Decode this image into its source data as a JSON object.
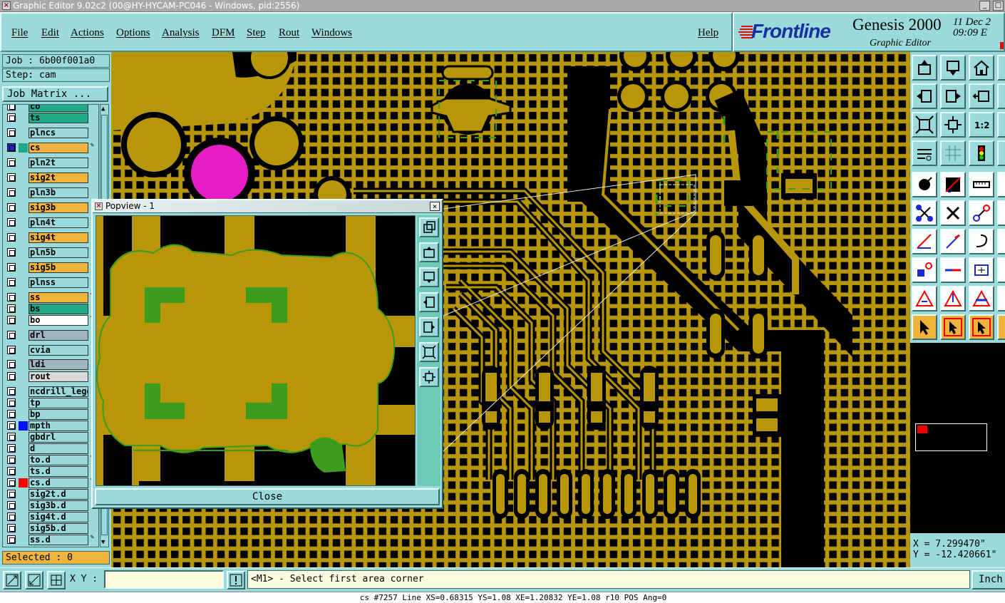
{
  "window": {
    "title": "Graphic Editor 9.02c2 (00@HY-HYCAM-PC046 - Windows, pid:2556)"
  },
  "menu": [
    "File",
    "Edit",
    "Actions",
    "Options",
    "Analysis",
    "DFM",
    "Step",
    "Rout",
    "Windows"
  ],
  "help_label": "Help",
  "brand": {
    "logo": "Frontline",
    "product": "Genesis 2000",
    "subtitle": "Graphic Editor",
    "date": "11 Dec 2\n09:09 E"
  },
  "job": {
    "job_label": "Job : 6b00f001a0",
    "step_label": "Step: cam",
    "matrix_button": "Job Matrix ..."
  },
  "layers": [
    {
      "name": "co",
      "color": "#1fa987",
      "tool": ""
    },
    {
      "name": "ts",
      "color": "#1fa987",
      "tool": ""
    },
    {
      "name": "plncs",
      "color": "#9bdada",
      "tool": ""
    },
    {
      "name": "cs",
      "color": "#f0b43c",
      "tool": "✎",
      "active": true
    },
    {
      "name": "pln2t",
      "color": "#9bdada",
      "tool": ""
    },
    {
      "name": "sig2t",
      "color": "#f0b43c",
      "tool": ""
    },
    {
      "name": "pln3b",
      "color": "#9bdada",
      "tool": ""
    },
    {
      "name": "sig3b",
      "color": "#f0b43c",
      "tool": ""
    },
    {
      "name": "pln4t",
      "color": "#9bdada",
      "tool": ""
    },
    {
      "name": "sig4t",
      "color": "#f0b43c",
      "tool": ""
    },
    {
      "name": "pln5b",
      "color": "#9bdada",
      "tool": ""
    },
    {
      "name": "sig5b",
      "color": "#f0b43c",
      "tool": ""
    },
    {
      "name": "plnss",
      "color": "#9bdada",
      "tool": ""
    },
    {
      "name": "ss",
      "color": "#f0b43c",
      "tool": "✎"
    },
    {
      "name": "bs",
      "color": "#1fa987",
      "tool": ""
    },
    {
      "name": "bo",
      "color": "#ffffff",
      "tool": "✎"
    },
    {
      "name": "drl",
      "color": "#a0b4c0",
      "tool": ""
    },
    {
      "name": "cvia",
      "color": "#9bdada",
      "tool": ""
    },
    {
      "name": "ldi",
      "color": "#a0b4c0",
      "tool": ""
    },
    {
      "name": "rout",
      "color": "#d8d8d8",
      "tool": ""
    },
    {
      "name": "ncdrill_lege",
      "color": "#9bdada",
      "tool": ""
    },
    {
      "name": "tp",
      "color": "#9bdada",
      "tool": ""
    },
    {
      "name": "bp",
      "color": "#9bdada",
      "tool": ""
    },
    {
      "name": "mpth",
      "color": "#9bdada",
      "tool": "",
      "swatch": "#0010ff"
    },
    {
      "name": "gbdrl",
      "color": "#9bdada",
      "tool": ""
    },
    {
      "name": "d",
      "color": "#9bdada",
      "tool": ""
    },
    {
      "name": "to.d",
      "color": "#9bdada",
      "tool": "✎"
    },
    {
      "name": "ts.d",
      "color": "#9bdada",
      "tool": ""
    },
    {
      "name": "cs.d",
      "color": "#9bdada",
      "tool": "✎",
      "swatch": "#ff0000"
    },
    {
      "name": "sig2t.d",
      "color": "#9bdada",
      "tool": ""
    },
    {
      "name": "sig3b.d",
      "color": "#9bdada",
      "tool": ""
    },
    {
      "name": "sig4t.d",
      "color": "#9bdada",
      "tool": ""
    },
    {
      "name": "sig5b.d",
      "color": "#9bdada",
      "tool": ""
    },
    {
      "name": "ss.d",
      "color": "#9bdada",
      "tool": "✎"
    }
  ],
  "selected_label": "Selected : 0",
  "popview": {
    "title": "Popview - 1",
    "close_label": "Close"
  },
  "coords": {
    "x": "X = 7.299470\"",
    "y": "Y = -12.420661\""
  },
  "input": {
    "xy_label": "X Y :",
    "xy_value": "",
    "prompt": "<M1> - Select first area corner",
    "units": "Inch"
  },
  "status": "cs #7257 Line XS=0.68315 YS=1.08 XE=1.20832 YE=1.08 r10 POS Ang=0",
  "colors": {
    "copper": "#b8960a",
    "highlight": "#e61ec8",
    "mask_green": "#3c9c1e",
    "panel": "#9bdada",
    "accent_orange": "#f0b43c"
  },
  "toolbox_icons": [
    "pan-up-icon",
    "pan-down-icon",
    "home-icon",
    "reserved",
    "pan-left-icon",
    "pan-right-icon",
    "zoom-window-icon",
    "reserved",
    "fit-all-icon",
    "fit-layer-icon",
    "zoom-1to1-icon",
    "reserved",
    "snap-icon",
    "grid-icon",
    "display-control-icon",
    "reserved",
    "measure-icon",
    "edit-rect-icon",
    "ruler-icon",
    "reserved",
    "move-nodes-icon",
    "cut-icon",
    "select-point-icon",
    "reserved",
    "draw-line-icon",
    "line-tool-icon",
    "arc-tool-icon",
    "reserved",
    "pad-tool-icon",
    "line-red-icon",
    "box-tool-icon",
    "reserved",
    "triangle-icon",
    "triangle-outline-icon",
    "triangle-a-icon",
    "reserved",
    "pointer-icon",
    "select-cursor-icon",
    "select-cursor-b-icon",
    "reserved"
  ]
}
